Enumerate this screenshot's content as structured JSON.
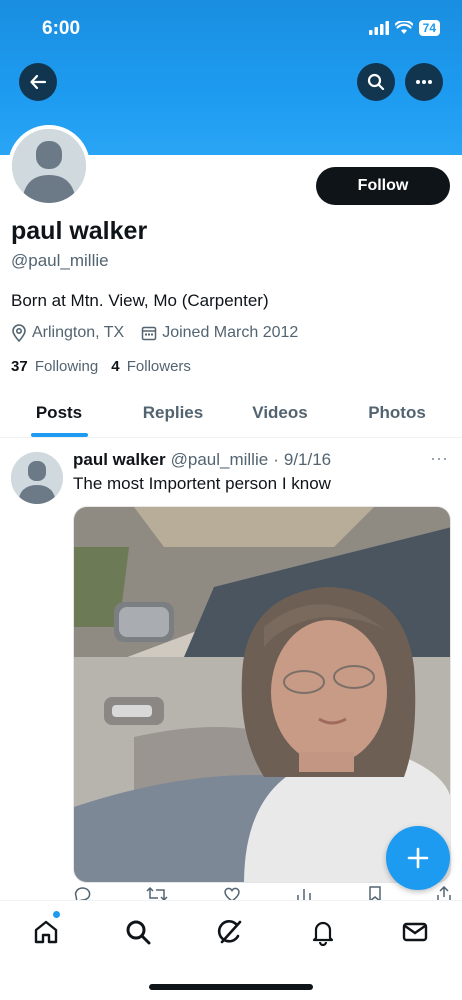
{
  "status_bar": {
    "time": "6:00",
    "battery": "74"
  },
  "profile": {
    "name": "paul walker",
    "handle": "@paul_millie",
    "bio": "Born at Mtn. View, Mo (Carpenter)",
    "location": "Arlington, TX",
    "joined": "Joined March 2012",
    "following_count": "37",
    "following_label": "Following",
    "followers_count": "4",
    "followers_label": "Followers",
    "follow_label": "Follow"
  },
  "tabs": [
    {
      "label": "Posts",
      "active": true
    },
    {
      "label": "Replies",
      "active": false
    },
    {
      "label": "Videos",
      "active": false
    },
    {
      "label": "Photos",
      "active": false
    }
  ],
  "post": {
    "author": "paul walker",
    "handle": "@paul_millie",
    "separator": "·",
    "date": "9/1/16",
    "text": "The most Importent person I know",
    "more": "···"
  },
  "icons": {
    "back": "arrow-left-icon",
    "search": "search-icon",
    "more": "more-horizontal-icon",
    "compose": "plus-icon",
    "nav": [
      "home-icon",
      "search-icon",
      "grok-icon",
      "bell-icon",
      "mail-icon"
    ]
  },
  "colors": {
    "accent": "#1d9bf0",
    "text": "#0f1419",
    "muted": "#536471"
  }
}
